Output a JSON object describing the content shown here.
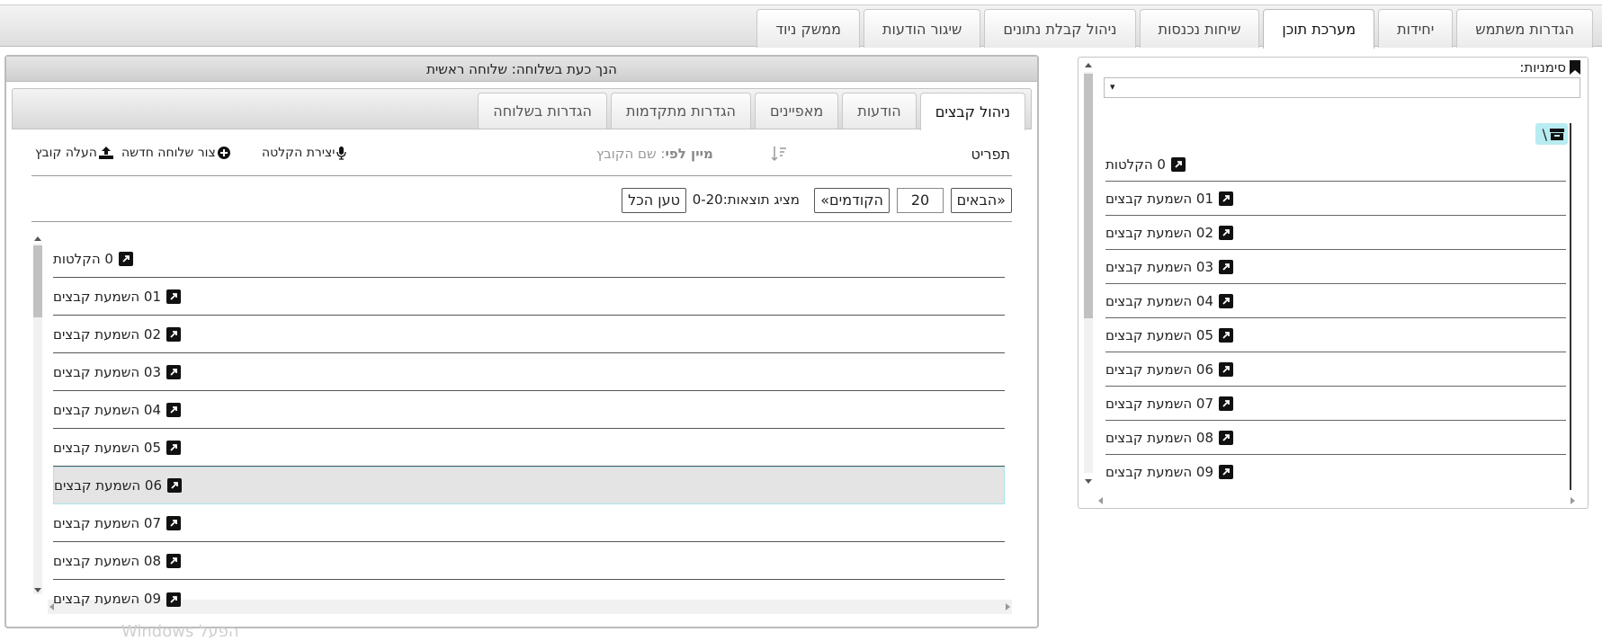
{
  "top_tabs": [
    {
      "label": "הגדרות משתמש",
      "active": false
    },
    {
      "label": "יחידות",
      "active": false
    },
    {
      "label": "מערכת תוכן",
      "active": true
    },
    {
      "label": "שיחות נכנסות",
      "active": false
    },
    {
      "label": "ניהול קבלת נתונים",
      "active": false
    },
    {
      "label": "שיגור הודעות",
      "active": false
    },
    {
      "label": "ממשק ניוד",
      "active": false
    }
  ],
  "bookmarks": {
    "label": "סימניות:",
    "select_value": "▾"
  },
  "tree": {
    "root_label": "\\",
    "items": [
      "0 הקלטות",
      "01 השמעת קבצים",
      "02 השמעת קבצים",
      "03 השמעת קבצים",
      "04 השמעת קבצים",
      "05 השמעת קבצים",
      "06 השמעת קבצים",
      "07 השמעת קבצים",
      "08 השמעת קבצים",
      "09 השמעת קבצים"
    ]
  },
  "main": {
    "title": "הנך כעת בשלוחה: שלוחה ראשית",
    "tabs": [
      {
        "label": "ניהול קבצים",
        "active": true
      },
      {
        "label": "הודעות",
        "active": false
      },
      {
        "label": "מאפיינים",
        "active": false
      },
      {
        "label": "הגדרות מתקדמות",
        "active": false
      },
      {
        "label": "הגדרות בשלוחה",
        "active": false
      }
    ],
    "toolbar": {
      "menu_label": "תפריט",
      "sort_label": "מיין לפי",
      "sort_value": ": שם הקובץ",
      "create_recording": "יצירת הקלטה",
      "new_extension": "צור שלוחה חדשה",
      "upload_file": "העלה קובץ"
    },
    "pager": {
      "next": "«הבאים",
      "page_size": "20",
      "prev": "הקודמים»",
      "showing": "מציג תוצאות:0-20",
      "load_all": "טען הכל"
    },
    "files": [
      "0 הקלטות",
      "01 השמעת קבצים",
      "02 השמעת קבצים",
      "03 השמעת קבצים",
      "04 השמעת קבצים",
      "05 השמעת קבצים",
      "06 השמעת קבצים",
      "07 השמעת קבצים",
      "08 השמעת קבצים",
      "09 השמעת קבצים"
    ],
    "selected_index": 6
  },
  "watermark": "Windows הפעל"
}
